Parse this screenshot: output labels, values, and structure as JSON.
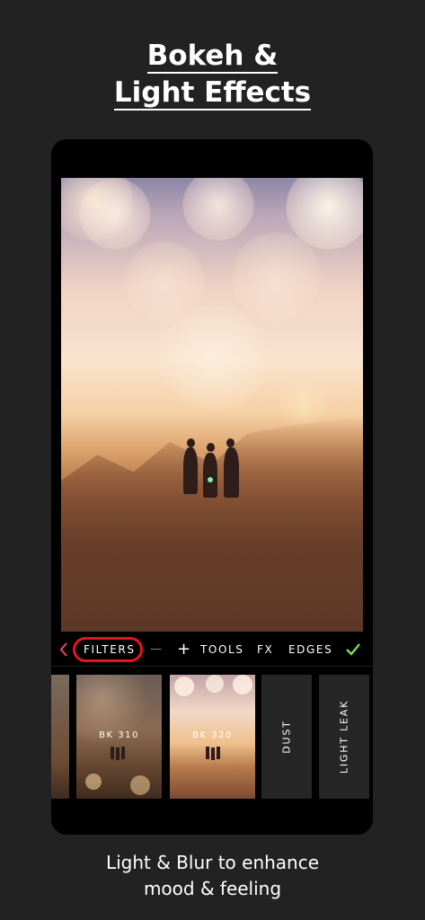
{
  "headline": {
    "line1": "Bokeh &",
    "line2": "Light Effects"
  },
  "toolbar": {
    "back_icon": "chevron-left-icon",
    "filters": "FILTERS",
    "minus": "—",
    "plus": "+",
    "tools": "TOOLS",
    "fx": "FX",
    "edges": "EDGES",
    "confirm_icon": "checkmark-icon"
  },
  "filters": [
    {
      "label": "BK 310"
    },
    {
      "label": "BK 320"
    },
    {
      "label": "DUST"
    },
    {
      "label": "LIGHT LEAK"
    }
  ],
  "caption": {
    "line1": "Light & Blur to enhance",
    "line2": "mood & feeling"
  },
  "colors": {
    "accent_check": "#7ed957",
    "highlight_ring": "#e3161b",
    "background": "#222222"
  }
}
